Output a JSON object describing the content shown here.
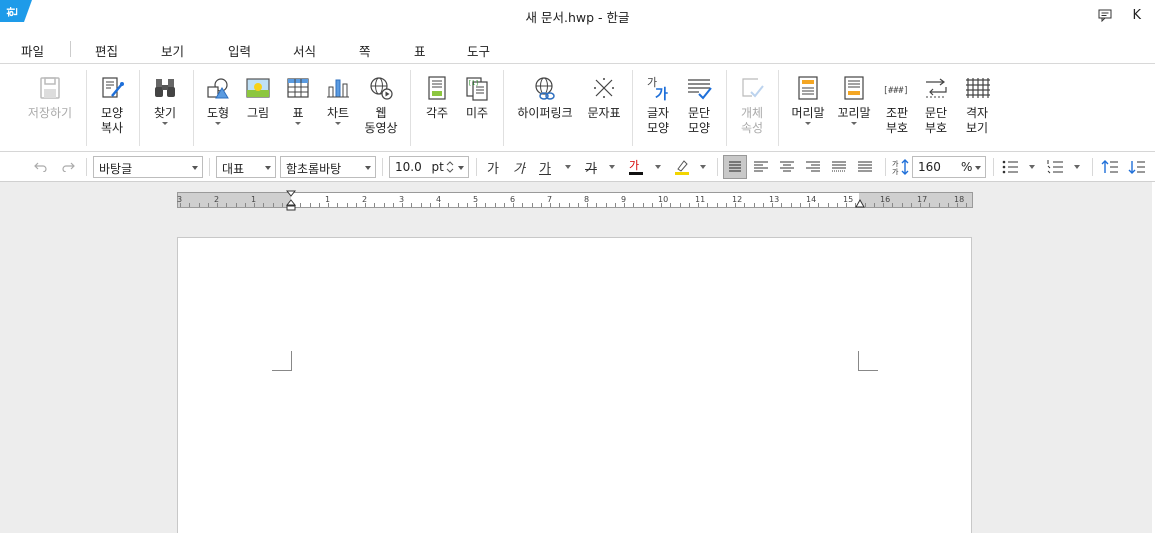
{
  "titlebar": {
    "title": "새 문서.hwp - 한글",
    "user_initial": "K",
    "logo_text": "한"
  },
  "menu": {
    "items": [
      "파일",
      "편집",
      "보기",
      "입력",
      "서식",
      "쪽",
      "표",
      "도구"
    ]
  },
  "ribbon": {
    "save_as": "저장하기",
    "copy_format_1": "모양",
    "copy_format_2": "복사",
    "find": "찾기",
    "shape": "도형",
    "picture": "그림",
    "table": "표",
    "chart": "차트",
    "web_video_1": "웹",
    "web_video_2": "동영상",
    "footnote": "각주",
    "endnote": "미주",
    "hyperlink": "하이퍼링크",
    "char_map": "문자표",
    "char_shape_1": "글자",
    "char_shape_2": "모양",
    "para_shape_1": "문단",
    "para_shape_2": "모양",
    "object_prop_1": "개체",
    "object_prop_2": "속성",
    "header": "머리말",
    "footer": "꼬리말",
    "layout_code_1": "조판",
    "layout_code_2": "부호",
    "para_mark_1": "문단",
    "para_mark_2": "부호",
    "grid_view_1": "격자",
    "grid_view_2": "보기",
    "char_shape_icon_text": "가",
    "layout_code_icon_text": "[###]"
  },
  "format": {
    "style": "바탕글",
    "language": "대표",
    "font": "함초롬바탕",
    "font_size": "10.0",
    "font_unit": "pt",
    "bold": "가",
    "italic": "가",
    "underline": "가",
    "strike": "가",
    "font_color": "가",
    "line_spacing": "160",
    "line_spacing_unit": "%"
  },
  "ruler": {
    "labels": [
      "3",
      "2",
      "1",
      "1",
      "2",
      "3",
      "4",
      "5",
      "6",
      "7",
      "8",
      "9",
      "10",
      "11",
      "12",
      "13",
      "14",
      "15",
      "16",
      "17",
      "18"
    ]
  },
  "colors": {
    "accent": "#1e9be9",
    "font_color_bar": "#d40000",
    "highlight_bar": "#f2d500"
  }
}
